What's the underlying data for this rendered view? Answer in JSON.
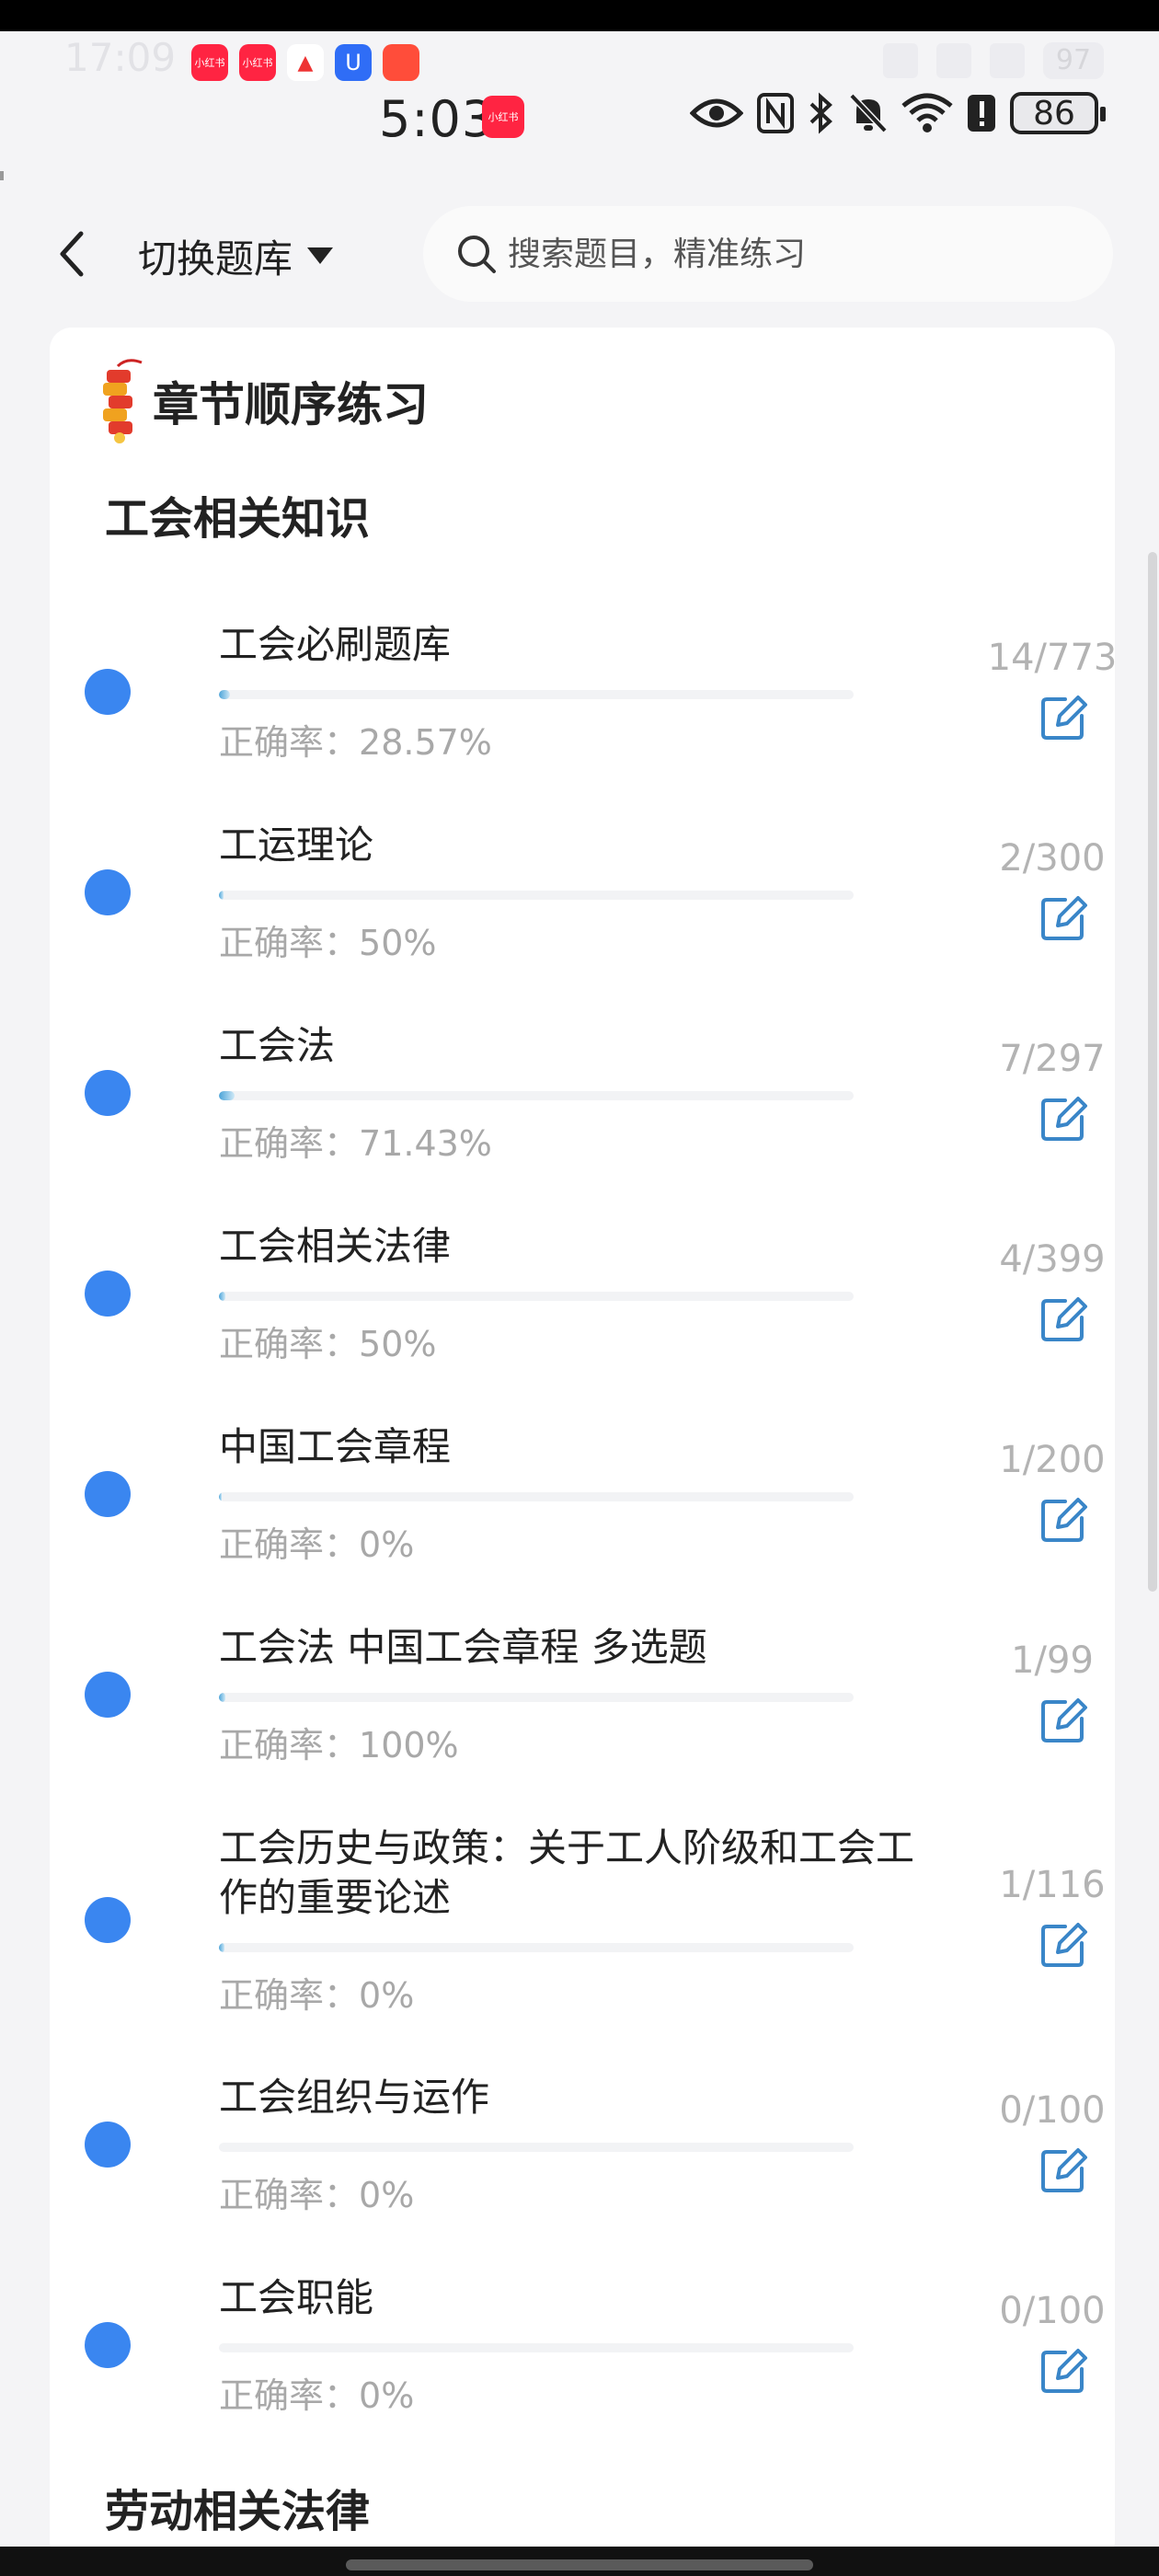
{
  "ghost_status": {
    "time": "17:09",
    "battery": "97"
  },
  "status_bar": {
    "time": "5:03",
    "badge": "小红书",
    "battery": "86"
  },
  "app_icons": [
    {
      "label": "小红书",
      "color": "#ff2442"
    },
    {
      "label": "小红书",
      "color": "#ff2442"
    },
    {
      "label": "A",
      "color": "#ffffff"
    },
    {
      "label": "U",
      "color": "#2f6df6"
    },
    {
      "label": "",
      "color": "#ff4d3a"
    }
  ],
  "header": {
    "switch_label": "切换题库",
    "search_placeholder": "搜索题目，精准练习"
  },
  "section": {
    "title": "章节顺序练习"
  },
  "groups": [
    {
      "title": "工会相关知识"
    },
    {
      "title": "劳动相关法律"
    }
  ],
  "accuracy_prefix": "正确率：",
  "chapters": [
    {
      "name": "工会必刷题库",
      "accuracy": "28.57%",
      "count": "14/773",
      "progress": 0.018
    },
    {
      "name": "工运理论",
      "accuracy": "50%",
      "count": "2/300",
      "progress": 0.007
    },
    {
      "name": "工会法",
      "accuracy": "71.43%",
      "count": "7/297",
      "progress": 0.024
    },
    {
      "name": "工会相关法律",
      "accuracy": "50%",
      "count": "4/399",
      "progress": 0.01
    },
    {
      "name": "中国工会章程",
      "accuracy": "0%",
      "count": "1/200",
      "progress": 0.005
    },
    {
      "name": "工会法 中国工会章程 多选题",
      "accuracy": "100%",
      "count": "1/99",
      "progress": 0.01
    },
    {
      "name": "工会历史与政策：关于工人阶级和工会工作的重要论述",
      "accuracy": "0%",
      "count": "1/116",
      "progress": 0.009
    },
    {
      "name": "工会组织与运作",
      "accuracy": "0%",
      "count": "0/100",
      "progress": 0
    },
    {
      "name": "工会职能",
      "accuracy": "0%",
      "count": "0/100",
      "progress": 0
    }
  ],
  "colors": {
    "accent": "#3a86f0",
    "progress": "#4aa3d8",
    "muted": "#a8a8a8"
  }
}
